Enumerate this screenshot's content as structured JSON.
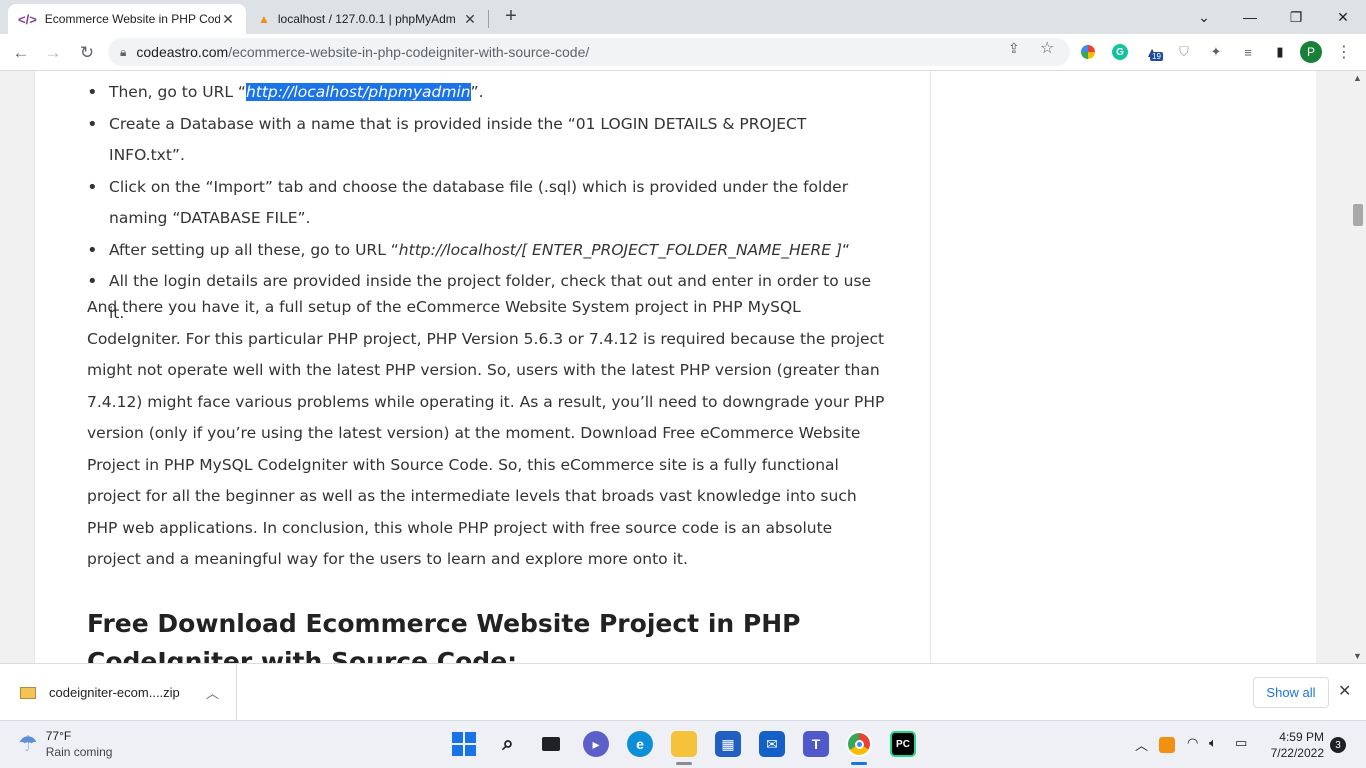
{
  "browser": {
    "tabs": [
      {
        "title": "Ecommerce Website in PHP Code",
        "active": true
      },
      {
        "title": "localhost / 127.0.0.1 | phpMyAdm",
        "active": false
      }
    ],
    "new_tab": "+",
    "url_domain": "codeastro.com",
    "url_path": "/ecommerce-website-in-php-codeigniter-with-source-code/",
    "profile_initial": "P",
    "extension_badge": "19"
  },
  "article": {
    "bullets": {
      "b1_pre": "Then, go to URL “",
      "b1_link": "http://localhost/phpmyadmin",
      "b1_post": "”.",
      "b2": "Create a Database with a name that is provided inside the “01 LOGIN DETAILS & PROJECT INFO.txt”.",
      "b3": "Click on the “Import” tab and choose the database file (.sql) which is provided under the folder naming “DATABASE FILE”.",
      "b4_pre": "After setting up all these, go to URL “",
      "b4_url": "http://localhost/[ ENTER_PROJECT_FOLDER_NAME_HERE ]",
      "b4_post": "“",
      "b5": "All the login details are provided inside the project folder, check that out and enter in order to use it."
    },
    "paragraph": "And there you have it, a full setup of the eCommerce Website System project in PHP MySQL CodeIgniter. For this particular PHP project, PHP Version 5.6.3 or 7.4.12 is required because the project might not operate well with the latest PHP version. So, users with the latest PHP version (greater than 7.4.12) might face various problems while operating it. As a result, you’ll need to downgrade your PHP version (only if you’re using the latest version) at the moment. Download Free eCommerce Website Project in PHP MySQL CodeIgniter with Source Code. So, this eCommerce site is a fully functional project for all the beginner as well as the intermediate levels that broads vast knowledge into such PHP web applications. In conclusion, this whole PHP project with free source code is an absolute project and a meaningful way for the users to learn and explore more onto it.",
    "heading": "Free Download Ecommerce Website Project in PHP CodeIgniter with Source Code:"
  },
  "downloads": {
    "file_name": "codeigniter-ecom....zip",
    "show_all": "Show all"
  },
  "taskbar": {
    "temperature": "77°F",
    "weather_desc": "Rain coming",
    "time": "4:59 PM",
    "date": "7/22/2022",
    "notification_count": "3",
    "pycharm_label": "PC"
  },
  "colors": {
    "selection": "#1a73e8",
    "tabstrip": "#dee1e6",
    "profile": "#188038"
  }
}
